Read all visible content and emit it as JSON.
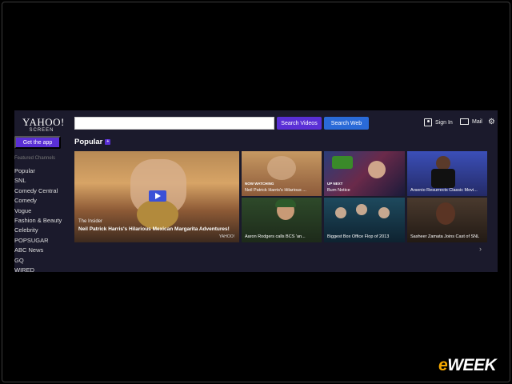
{
  "header": {
    "logo_line1": "YAHOO!",
    "logo_line2": "SCREEN",
    "search_value": "",
    "search_videos_label": "Search Videos",
    "search_web_label": "Search Web",
    "sign_in_label": "Sign In",
    "mail_label": "Mail"
  },
  "sidebar": {
    "get_app_label": "Get the app",
    "section_label": "Featured Channels",
    "items": [
      "Popular",
      "SNL",
      "Comedy Central",
      "Comedy",
      "Vogue",
      "Fashion & Beauty",
      "Celebrity",
      "POPSUGAR",
      "ABC News",
      "GQ",
      "WIRED"
    ]
  },
  "main": {
    "section_title": "Popular",
    "featured": {
      "source": "The Insider",
      "title": "Neil Patrick Harris's Hilarious Mexican Margarita Adventures!",
      "watermark": "YAHOO!"
    },
    "tiles": [
      {
        "tag": "NOW WATCHING",
        "caption": "Neil Patrick Harris's Hilarious ..."
      },
      {
        "tag": "UP NEXT",
        "caption": "Burn Notice"
      },
      {
        "tag": "",
        "caption": "Arsenio Resurrects Classic Movi..."
      },
      {
        "tag": "",
        "caption": "Aaron Rodgers calls BCS 'an..."
      },
      {
        "tag": "",
        "caption": "Biggest Box Office Flop of 2013"
      },
      {
        "tag": "",
        "caption": "Sasheer Zamata Joins Cast of SNL"
      }
    ]
  },
  "brand": {
    "e": "e",
    "rest": "WEEK"
  },
  "colors": {
    "accent_purple": "#5a2fd6",
    "accent_blue": "#2a6ad8",
    "background": "#1b1a2c"
  }
}
